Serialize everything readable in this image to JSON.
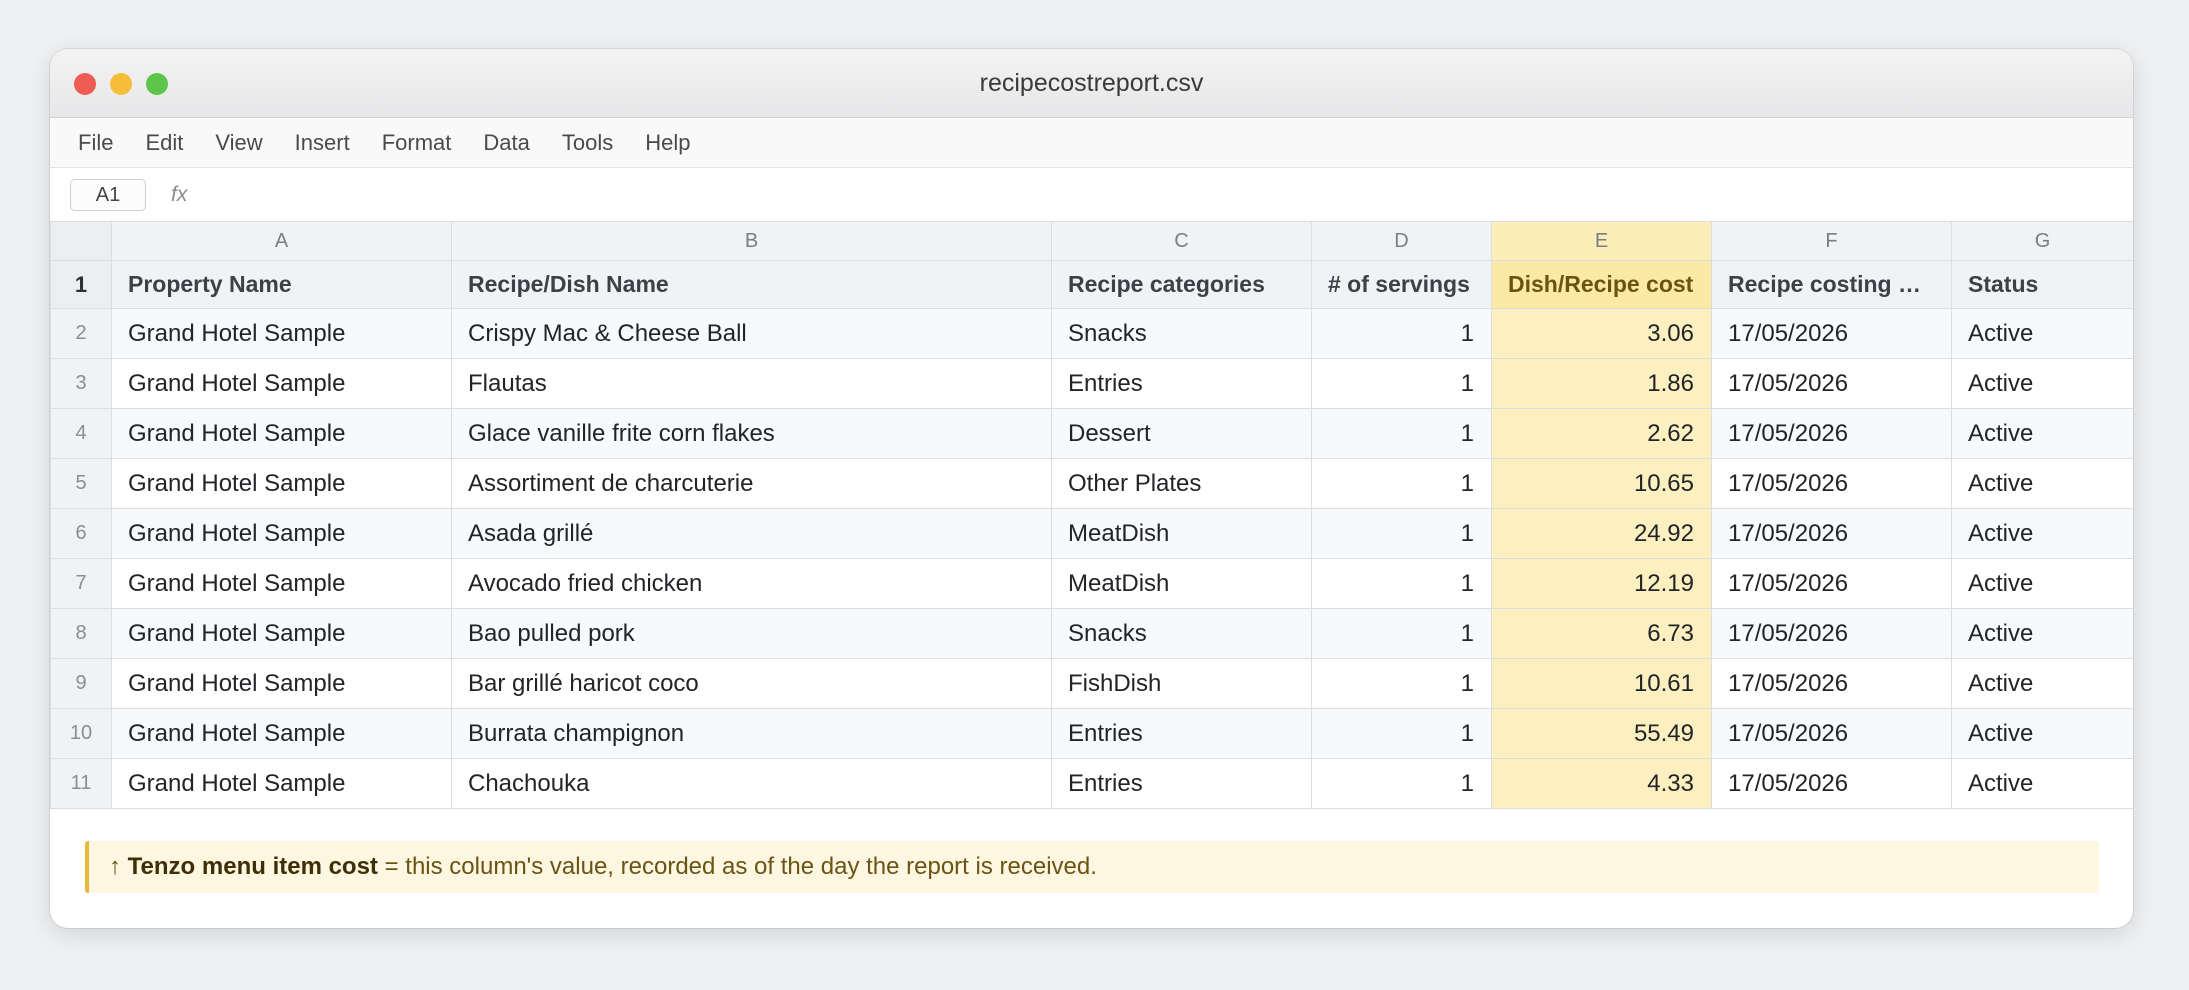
{
  "window": {
    "title": "recipecostreport.csv"
  },
  "menu": [
    "File",
    "Edit",
    "View",
    "Insert",
    "Format",
    "Data",
    "Tools",
    "Help"
  ],
  "formula_bar": {
    "cell_ref": "A1",
    "fx_label": "fx",
    "value": ""
  },
  "sheet": {
    "column_letters": [
      "A",
      "B",
      "C",
      "D",
      "E",
      "F",
      "G"
    ],
    "header_row_number": "1",
    "headers": [
      "Property Name",
      "Recipe/Dish Name",
      "Recipe categories",
      "# of servings",
      "Dish/Recipe cost",
      "Recipe costing …",
      "Status"
    ],
    "highlighted_column": "E",
    "rows": [
      {
        "num": "2",
        "cells": [
          "Grand Hotel Sample",
          "Crispy Mac & Cheese Ball",
          "Snacks",
          "1",
          "3.06",
          "17/05/2026",
          "Active"
        ]
      },
      {
        "num": "3",
        "cells": [
          "Grand Hotel Sample",
          "Flautas",
          "Entries",
          "1",
          "1.86",
          "17/05/2026",
          "Active"
        ]
      },
      {
        "num": "4",
        "cells": [
          "Grand Hotel Sample",
          "Glace vanille frite corn flakes",
          "Dessert",
          "1",
          "2.62",
          "17/05/2026",
          "Active"
        ]
      },
      {
        "num": "5",
        "cells": [
          "Grand Hotel Sample",
          "Assortiment de charcuterie",
          "Other Plates",
          "1",
          "10.65",
          "17/05/2026",
          "Active"
        ]
      },
      {
        "num": "6",
        "cells": [
          "Grand Hotel Sample",
          "Asada grillé",
          "MeatDish",
          "1",
          "24.92",
          "17/05/2026",
          "Active"
        ]
      },
      {
        "num": "7",
        "cells": [
          "Grand Hotel Sample",
          "Avocado fried chicken",
          "MeatDish",
          "1",
          "12.19",
          "17/05/2026",
          "Active"
        ]
      },
      {
        "num": "8",
        "cells": [
          "Grand Hotel Sample",
          "Bao pulled pork",
          "Snacks",
          "1",
          "6.73",
          "17/05/2026",
          "Active"
        ]
      },
      {
        "num": "9",
        "cells": [
          "Grand Hotel Sample",
          "Bar grillé haricot coco",
          "FishDish",
          "1",
          "10.61",
          "17/05/2026",
          "Active"
        ]
      },
      {
        "num": "10",
        "cells": [
          "Grand Hotel Sample",
          "Burrata champignon",
          "Entries",
          "1",
          "55.49",
          "17/05/2026",
          "Active"
        ]
      },
      {
        "num": "11",
        "cells": [
          "Grand Hotel Sample",
          "Chachouka",
          "Entries",
          "1",
          "4.33",
          "17/05/2026",
          "Active"
        ]
      }
    ]
  },
  "note": {
    "arrow": "↑",
    "bold_text": "Tenzo menu item cost",
    "rest_text": " = this column's value, recorded as of the day the report is received."
  },
  "colors": {
    "highlight": "#fdf0c0",
    "note_border": "#e6b93a",
    "close": "#ee5c53",
    "minimize": "#f6bd3b",
    "maximize": "#5dc64a"
  }
}
